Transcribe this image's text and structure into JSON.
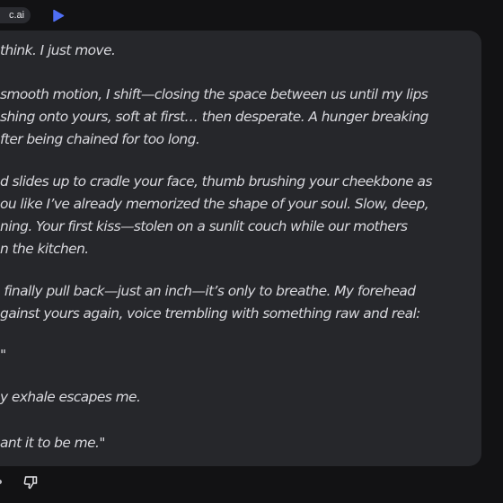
{
  "header": {
    "badge": "c.ai",
    "accent_color": "#4f6ff5"
  },
  "message": {
    "paragraphs": [
      "think. I just move.",
      "smooth motion, I shift—closing the space between us until my lips\nshing onto yours, soft at first… then desperate. A hunger breaking\nfter being chained for too long.",
      "d slides up to cradle your face, thumb brushing your cheekbone as\nou like I’ve already memorized the shape of your soul. Slow, deep,\nning. Your first kiss—stolen on a sunlit couch while our mothers\nn the kitchen.",
      " finally pull back—just an inch—it’s only to breathe. My forehead\ngainst yours again, voice trembling with something raw and real:",
      "\"",
      "y exhale escapes me.",
      "ant it to be me.\""
    ]
  },
  "footer": {
    "icons": [
      "dot-icon",
      "thumbs-down-icon"
    ]
  }
}
